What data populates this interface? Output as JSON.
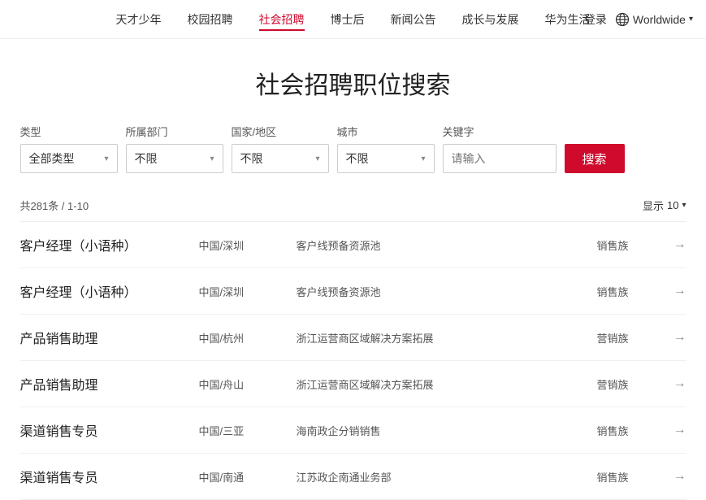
{
  "nav": {
    "items": [
      {
        "label": "天才少年",
        "active": false
      },
      {
        "label": "校园招聘",
        "active": false
      },
      {
        "label": "社会招聘",
        "active": true
      },
      {
        "label": "博士后",
        "active": false
      },
      {
        "label": "新闻公告",
        "active": false
      },
      {
        "label": "成长与发展",
        "active": false
      },
      {
        "label": "华为生活",
        "active": false
      }
    ],
    "login": "登录",
    "worldwide": "Worldwide"
  },
  "page": {
    "title": "社会招聘职位搜索"
  },
  "filters": {
    "type_label": "类型",
    "type_value": "全部类型",
    "dept_label": "所属部门",
    "dept_value": "不限",
    "country_label": "国家/地区",
    "country_value": "不限",
    "city_label": "城市",
    "city_value": "不限",
    "keyword_label": "关键字",
    "keyword_placeholder": "请输入",
    "search_btn": "搜索"
  },
  "results": {
    "total_text": "共281条 / 1-10",
    "display_label": "显示",
    "display_count": "10"
  },
  "jobs": [
    {
      "title": "客户经理（小语种）",
      "location": "中国/深圳",
      "dept": "客户线预备资源池",
      "category": "销售族",
      "arrow": "→"
    },
    {
      "title": "客户经理（小语种）",
      "location": "中国/深圳",
      "dept": "客户线预备资源池",
      "category": "销售族",
      "arrow": "→"
    },
    {
      "title": "产品销售助理",
      "location": "中国/杭州",
      "dept": "浙江运营商区域解决方案拓展",
      "category": "营销族",
      "arrow": "→"
    },
    {
      "title": "产品销售助理",
      "location": "中国/舟山",
      "dept": "浙江运营商区域解决方案拓展",
      "category": "营销族",
      "arrow": "→"
    },
    {
      "title": "渠道销售专员",
      "location": "中国/三亚",
      "dept": "海南政企分销销售",
      "category": "销售族",
      "arrow": "→"
    },
    {
      "title": "渠道销售专员",
      "location": "中国/南通",
      "dept": "江苏政企南通业务部",
      "category": "销售族",
      "arrow": "→"
    }
  ]
}
